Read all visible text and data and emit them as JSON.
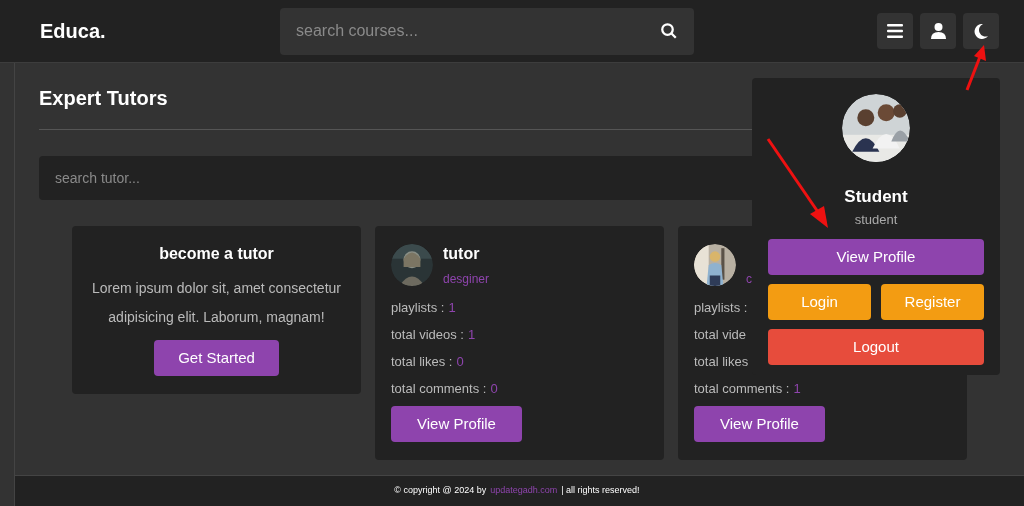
{
  "header": {
    "logo": "Educa.",
    "search": {
      "placeholder": "search courses..."
    }
  },
  "section": {
    "title": "Expert Tutors",
    "search": {
      "placeholder": "search tutor..."
    }
  },
  "become_tutor": {
    "title": "become a tutor",
    "text": "Lorem ipsum dolor sit, amet consectetur adipisicing elit. Laborum, magnam!",
    "button": "Get Started"
  },
  "tutors": [
    {
      "name": "tutor",
      "profession": "desginer",
      "stats": [
        {
          "label": "playlists :",
          "value": "1"
        },
        {
          "label": "total videos :",
          "value": "1"
        },
        {
          "label": "total likes :",
          "value": "0"
        },
        {
          "label": "total comments :",
          "value": "0"
        }
      ],
      "button": "View Profile"
    },
    {
      "profession": "c",
      "stats": [
        {
          "label": "playlists :"
        },
        {
          "label": "total vide"
        },
        {
          "label": "total likes"
        },
        {
          "label": "total comments :",
          "value": "1"
        }
      ],
      "button": "View Profile"
    }
  ],
  "profile_menu": {
    "name": "Student",
    "role": "student",
    "buttons": [
      {
        "label": "View Profile",
        "kind": "primary"
      },
      {
        "label": "Login",
        "kind": "warning"
      },
      {
        "label": "Register",
        "kind": "warning"
      },
      {
        "label": "Logout",
        "kind": "danger"
      }
    ]
  },
  "footer": {
    "prefix": "© copyright @ 2024 by",
    "link": "updategadh.com",
    "suffix": "| all rights reserved!"
  }
}
